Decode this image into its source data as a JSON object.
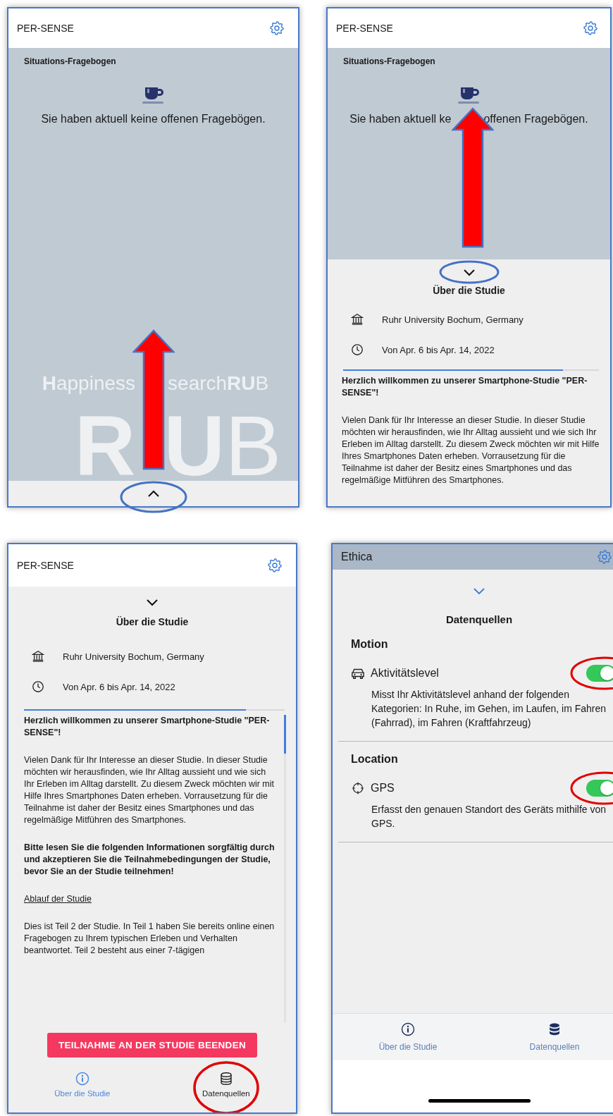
{
  "screens": [
    {
      "kind": "questionnaire",
      "app_title": "PER-SENSE",
      "section_title": "Situations-Fragebogen",
      "message_parts": [
        "Sie haben aktuell keine offenen Fragebögen."
      ],
      "watermark_parts": [
        "**H**appiness",
        "search**RU**B"
      ],
      "logo_parts": [
        "**R**",
        "**U**B"
      ]
    },
    {
      "kind": "questionnaire_peek",
      "app_title": "PER-SENSE",
      "section_title": "Situations-Fragebogen",
      "message_parts": [
        "Sie haben aktuell ke",
        "offenen Fragebögen."
      ],
      "sheet_title": "Über die Studie",
      "info": [
        "Ruhr University Bochum, Germany",
        "Von Apr. 6 bis Apr. 14, 2022"
      ],
      "level": 0.86,
      "paragraphs": [
        {
          "kind": "strong",
          "text": "Herzlich willkommen zu unserer Smartphone-Studie \"PER-SENSE\"!"
        },
        {
          "kind": "text",
          "text": "Vielen Dank für Ihr Interesse an dieser Studie. In dieser Studie möchten wir herausfinden, wie Ihr Alltag aussieht und wie sich Ihr Erleben im Alltag darstellt. Zu diesem Zweck möchten wir mit Hilfe Ihres Smartphones Daten erheben. Vorrausetzung für die Teilnahme ist daher der Besitz eines Smartphones und das regelmäßige Mitführen des Smartphones."
        }
      ]
    },
    {
      "kind": "about",
      "app_title": "PER-SENSE",
      "sheet_title": "Über die Studie",
      "info": [
        "Ruhr University Bochum, Germany",
        "Von Apr. 6 bis Apr. 14, 2022"
      ],
      "level": 0.85,
      "paragraphs": [
        {
          "kind": "strong",
          "text": "Herzlich willkommen zu unserer Smartphone-Studie \"PER-SENSE\"!"
        },
        {
          "kind": "text",
          "text": "Vielen Dank für Ihr Interesse an dieser Studie. In dieser Studie möchten wir herausfinden, wie Ihr Alltag aussieht und wie sich Ihr Erleben im Alltag darstellt. Zu diesem Zweck möchten wir mit Hilfe Ihres Smartphones Daten erheben. Vorrausetzung für die Teilnahme ist daher der Besitz eines Smartphones und das regelmäßige Mitführen des Smartphones."
        },
        {
          "kind": "strong",
          "text": "Bitte lesen Sie die folgenden Informationen sorgfältig durch und akzeptieren Sie die Teilnahmebedingungen der Studie, bevor Sie an der Studie teilnehmen!"
        },
        {
          "kind": "heading",
          "text": "Ablauf der Studie"
        },
        {
          "kind": "text",
          "text": "Dies ist Teil 2 der Studie. In Teil 1 haben Sie bereits online einen Fragebogen zu Ihrem typischen Erleben und Verhalten beantwortet. Teil 2 besteht aus einer 7-tägigen"
        }
      ],
      "button": "TEILNAHME AN DER STUDIE BEENDEN",
      "tabs": [
        {
          "label": "Über die Studie",
          "selected": true
        },
        {
          "label": "Datenquellen",
          "selected": false
        }
      ]
    },
    {
      "kind": "data_sources",
      "app_title": "Ethica",
      "sheet_title": "Datenquellen",
      "groups": [
        {
          "title": "Motion",
          "sources": [
            {
              "name": "Aktivitätslevel",
              "on": true,
              "description": "Misst Ihr Aktivitätslevel anhand der folgenden Kategorien: In Ruhe, im Gehen, im Laufen, im Fahren (Fahrrad), im Fahren (Kraftfahrzeug)"
            }
          ]
        },
        {
          "title": "Location",
          "sources": [
            {
              "name": "GPS",
              "on": true,
              "description": "Erfasst den genauen Standort des Geräts mithilfe von GPS."
            }
          ]
        }
      ],
      "tabs": [
        {
          "label": "Über die Studie",
          "selected": false
        },
        {
          "label": "Datenquellen",
          "selected": true
        }
      ]
    }
  ]
}
